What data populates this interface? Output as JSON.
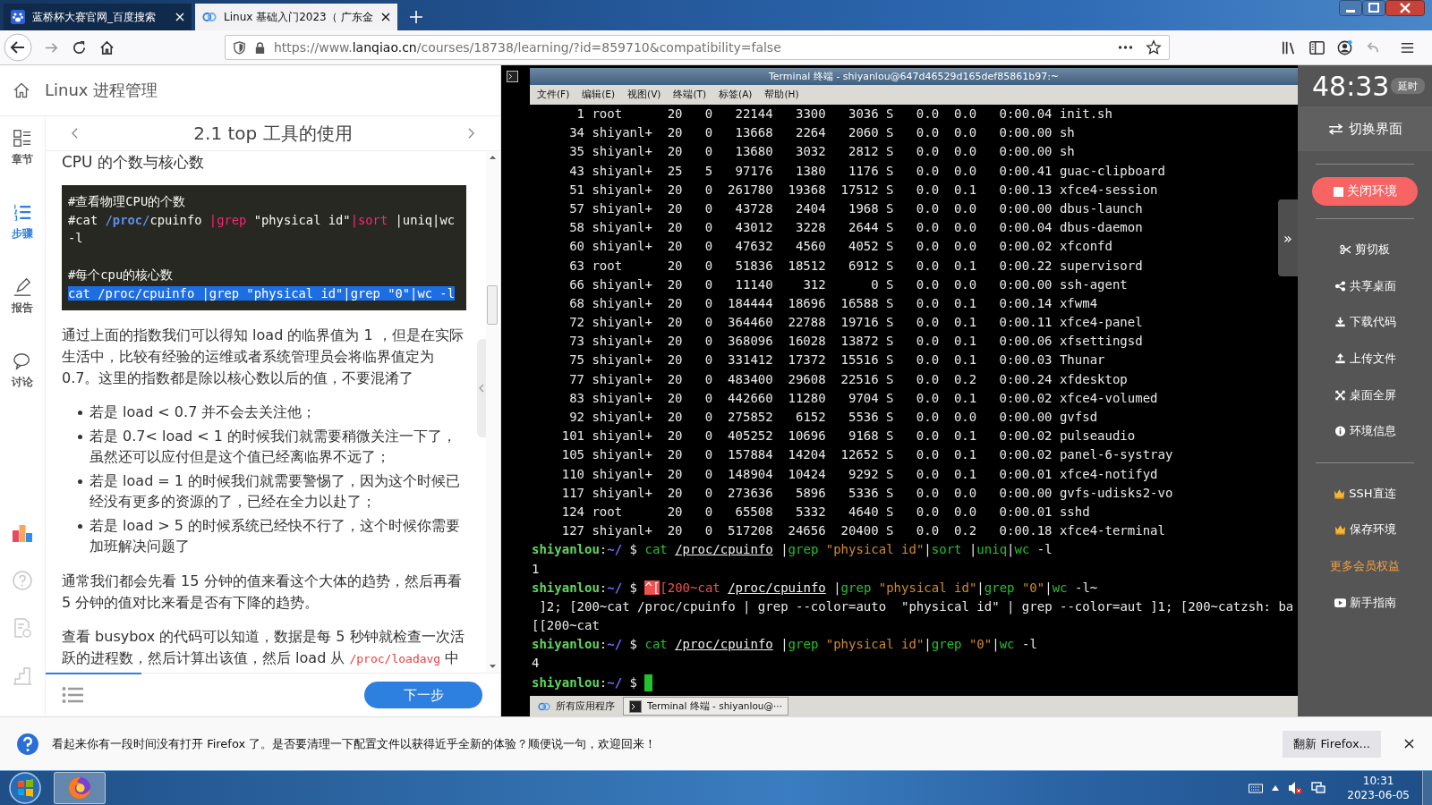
{
  "browser": {
    "tabs": [
      {
        "title": "蓝桥杯大赛官网_百度搜索",
        "kind": "baidu",
        "selected": false
      },
      {
        "title": "Linux 基础入门2023（ 广东金",
        "kind": "lanqiao",
        "selected": true
      }
    ],
    "url": {
      "prefix": "https://www.",
      "domain": "lanqiao.cn",
      "path": "/courses/18738/learning/?id=859710&compatibility=false"
    }
  },
  "course": {
    "title": "Linux 进程管理",
    "nav": [
      {
        "label": "章节",
        "kind": "chapters",
        "selected": false
      },
      {
        "label": "步骤",
        "kind": "steps",
        "selected": true
      },
      {
        "label": "报告",
        "kind": "report",
        "selected": false
      },
      {
        "label": "讨论",
        "kind": "discuss",
        "selected": false
      }
    ],
    "step_title": "2.1 top 工具的使用",
    "article": {
      "heading": "CPU 的个数与核心数",
      "code_blocks": [
        {
          "lines": [
            {
              "selected": false,
              "segments": [
                {
                  "text": "#查看物理CPU的个数",
                  "kind": "plain"
                }
              ]
            },
            {
              "selected": false,
              "segments": [
                {
                  "text": "#cat ",
                  "kind": "plain"
                },
                {
                  "text": "/proc/",
                  "kind": "path"
                },
                {
                  "text": "cpuinfo ",
                  "kind": "plain"
                },
                {
                  "text": "|grep",
                  "kind": "keyword"
                },
                {
                  "text": " \"physical id\"",
                  "kind": "plain"
                },
                {
                  "text": "|sort",
                  "kind": "keyword"
                },
                {
                  "text": " |uniq|wc -l",
                  "kind": "plain"
                }
              ]
            }
          ]
        },
        {
          "lines": [
            {
              "selected": false,
              "segments": [
                {
                  "text": "#每个cpu的核心数",
                  "kind": "plain"
                }
              ]
            },
            {
              "selected": true,
              "segments": [
                {
                  "text": "cat /proc/cpuinfo |grep \"physical id\"|grep \"0\"|wc -l",
                  "kind": "plain"
                }
              ]
            }
          ]
        }
      ],
      "paragraph_1": "通过上面的指数我们可以得知 load 的临界值为 1 ，但是在实际生活中，比较有经验的运维或者系统管理员会将临界值定为 0.7。这里的指数都是除以核心数以后的值，不要混淆了",
      "bullets": [
        "若是 load < 0.7 并不会去关注他；",
        "若是 0.7< load < 1 的时候我们就需要稍微关注一下了，虽然还可以应付但是这个值已经离临界不远了；",
        "若是 load = 1 的时候我们就需要警惕了，因为这个时候已经没有更多的资源的了，已经在全力以赴了；",
        "若是 load > 5 的时候系统已经快不行了，这个时候你需要加班解决问题了"
      ],
      "paragraph_2": "通常我们都会先看 15 分钟的值来看这个大体的趋势，然后再看 5 分钟的值对比来看是否有下降的趋势。",
      "paragraph_3": {
        "before": "查看 busybox 的代码可以知道，数据是每 5 秒钟就检查一次活跃的进程数，然后计算出该值，然后 load 从 ",
        "code": "/proc/loadavg",
        "after": " 中"
      }
    },
    "reading_progress": {
      "level": 0.21
    },
    "next_button": "下一步"
  },
  "terminal": {
    "title": "Terminal 终端 - shiyanlou@647d46529d165def85861b97:~",
    "menu": [
      "文件(F)",
      "编辑(E)",
      "视图(V)",
      "终端(T)",
      "标签(A)",
      "帮助(H)"
    ],
    "processes": [
      [
        "1",
        "root",
        "20",
        "0",
        "22144",
        "3300",
        "3036",
        "S",
        "0.0",
        "0.0",
        "0:00.04",
        "init.sh"
      ],
      [
        "34",
        "shiyanl+",
        "20",
        "0",
        "13668",
        "2264",
        "2060",
        "S",
        "0.0",
        "0.0",
        "0:00.00",
        "sh"
      ],
      [
        "35",
        "shiyanl+",
        "20",
        "0",
        "13680",
        "3032",
        "2812",
        "S",
        "0.0",
        "0.0",
        "0:00.00",
        "sh"
      ],
      [
        "43",
        "shiyanl+",
        "25",
        "5",
        "97176",
        "1380",
        "1176",
        "S",
        "0.0",
        "0.0",
        "0:00.41",
        "guac-clipboard"
      ],
      [
        "51",
        "shiyanl+",
        "20",
        "0",
        "261780",
        "19368",
        "17512",
        "S",
        "0.0",
        "0.1",
        "0:00.13",
        "xfce4-session"
      ],
      [
        "57",
        "shiyanl+",
        "20",
        "0",
        "43728",
        "2404",
        "1968",
        "S",
        "0.0",
        "0.0",
        "0:00.00",
        "dbus-launch"
      ],
      [
        "58",
        "shiyanl+",
        "20",
        "0",
        "43012",
        "3228",
        "2644",
        "S",
        "0.0",
        "0.0",
        "0:00.04",
        "dbus-daemon"
      ],
      [
        "60",
        "shiyanl+",
        "20",
        "0",
        "47632",
        "4560",
        "4052",
        "S",
        "0.0",
        "0.0",
        "0:00.02",
        "xfconfd"
      ],
      [
        "63",
        "root",
        "20",
        "0",
        "51836",
        "18512",
        "6912",
        "S",
        "0.0",
        "0.1",
        "0:00.22",
        "supervisord"
      ],
      [
        "66",
        "shiyanl+",
        "20",
        "0",
        "11140",
        "312",
        "0",
        "S",
        "0.0",
        "0.0",
        "0:00.00",
        "ssh-agent"
      ],
      [
        "68",
        "shiyanl+",
        "20",
        "0",
        "184444",
        "18696",
        "16588",
        "S",
        "0.0",
        "0.1",
        "0:00.14",
        "xfwm4"
      ],
      [
        "72",
        "shiyanl+",
        "20",
        "0",
        "364460",
        "22788",
        "19716",
        "S",
        "0.0",
        "0.1",
        "0:00.11",
        "xfce4-panel"
      ],
      [
        "73",
        "shiyanl+",
        "20",
        "0",
        "368096",
        "16028",
        "13872",
        "S",
        "0.0",
        "0.1",
        "0:00.06",
        "xfsettingsd"
      ],
      [
        "75",
        "shiyanl+",
        "20",
        "0",
        "331412",
        "17372",
        "15516",
        "S",
        "0.0",
        "0.1",
        "0:00.03",
        "Thunar"
      ],
      [
        "77",
        "shiyanl+",
        "20",
        "0",
        "483400",
        "29608",
        "22516",
        "S",
        "0.0",
        "0.2",
        "0:00.24",
        "xfdesktop"
      ],
      [
        "83",
        "shiyanl+",
        "20",
        "0",
        "442660",
        "11280",
        "9704",
        "S",
        "0.0",
        "0.1",
        "0:00.02",
        "xfce4-volumed"
      ],
      [
        "92",
        "shiyanl+",
        "20",
        "0",
        "275852",
        "6152",
        "5536",
        "S",
        "0.0",
        "0.0",
        "0:00.00",
        "gvfsd"
      ],
      [
        "101",
        "shiyanl+",
        "20",
        "0",
        "405252",
        "10696",
        "9168",
        "S",
        "0.0",
        "0.1",
        "0:00.02",
        "pulseaudio"
      ],
      [
        "105",
        "shiyanl+",
        "20",
        "0",
        "157884",
        "14204",
        "12652",
        "S",
        "0.0",
        "0.1",
        "0:00.02",
        "panel-6-systray"
      ],
      [
        "110",
        "shiyanl+",
        "20",
        "0",
        "148904",
        "10424",
        "9292",
        "S",
        "0.0",
        "0.1",
        "0:00.01",
        "xfce4-notifyd"
      ],
      [
        "117",
        "shiyanl+",
        "20",
        "0",
        "273636",
        "5896",
        "5336",
        "S",
        "0.0",
        "0.0",
        "0:00.00",
        "gvfs-udisks2-vo"
      ],
      [
        "124",
        "root",
        "20",
        "0",
        "65508",
        "5332",
        "4640",
        "S",
        "0.0",
        "0.0",
        "0:00.01",
        "sshd"
      ],
      [
        "127",
        "shiyanl+",
        "20",
        "0",
        "517208",
        "24656",
        "20400",
        "S",
        "0.0",
        "0.2",
        "0:00.18",
        "xfce4-terminal"
      ]
    ],
    "shell_lines": [
      {
        "cursor": false,
        "segments": [
          {
            "text": "shiyanlou",
            "kind": "user"
          },
          {
            "text": ":",
            "kind": "plain"
          },
          {
            "text": "~/",
            "kind": "path"
          },
          {
            "text": " $ ",
            "kind": "plain"
          },
          {
            "text": "cat ",
            "kind": "cmd"
          },
          {
            "text": "/proc/cpuinfo",
            "kind": "arg"
          },
          {
            "text": " |",
            "kind": "plain"
          },
          {
            "text": "grep ",
            "kind": "cmd"
          },
          {
            "text": "\"physical id\"",
            "kind": "str"
          },
          {
            "text": "|",
            "kind": "plain"
          },
          {
            "text": "sort",
            "kind": "cmd"
          },
          {
            "text": " |",
            "kind": "plain"
          },
          {
            "text": "uniq",
            "kind": "cmd"
          },
          {
            "text": "|",
            "kind": "plain"
          },
          {
            "text": "wc",
            "kind": "cmd"
          },
          {
            "text": " -l",
            "kind": "plain"
          }
        ]
      },
      {
        "cursor": false,
        "segments": [
          {
            "text": "1",
            "kind": "plain"
          }
        ]
      },
      {
        "cursor": false,
        "segments": [
          {
            "text": "shiyanlou",
            "kind": "user"
          },
          {
            "text": ":",
            "kind": "plain"
          },
          {
            "text": "~/",
            "kind": "path"
          },
          {
            "text": " $ ",
            "kind": "plain"
          },
          {
            "text": "^[",
            "kind": "esc"
          },
          {
            "text": "[200~cat ",
            "kind": "error"
          },
          {
            "text": "/proc/cpuinfo",
            "kind": "arg"
          },
          {
            "text": " |",
            "kind": "plain"
          },
          {
            "text": "grep ",
            "kind": "cmd"
          },
          {
            "text": "\"physical id\"",
            "kind": "str"
          },
          {
            "text": "|",
            "kind": "plain"
          },
          {
            "text": "grep ",
            "kind": "cmd"
          },
          {
            "text": "\"0\"",
            "kind": "str"
          },
          {
            "text": "|",
            "kind": "plain"
          },
          {
            "text": "wc",
            "kind": "cmd"
          },
          {
            "text": " -l~",
            "kind": "plain"
          }
        ]
      },
      {
        "cursor": false,
        "segments": [
          {
            "text": " ]2; [200~cat /proc/cpuinfo | grep --color=auto  \"physical id\" | grep --color=aut ]1; [200~catzsh: ba",
            "kind": "plain"
          }
        ]
      },
      {
        "cursor": false,
        "segments": [
          {
            "text": "[[200~cat",
            "kind": "plain"
          }
        ]
      },
      {
        "cursor": false,
        "segments": [
          {
            "text": "shiyanlou",
            "kind": "user"
          },
          {
            "text": ":",
            "kind": "plain"
          },
          {
            "text": "~/",
            "kind": "path"
          },
          {
            "text": " $ ",
            "kind": "plain"
          },
          {
            "text": "cat ",
            "kind": "cmd"
          },
          {
            "text": "/proc/cpuinfo",
            "kind": "arg"
          },
          {
            "text": " |",
            "kind": "plain"
          },
          {
            "text": "grep ",
            "kind": "cmd"
          },
          {
            "text": "\"physical id\"",
            "kind": "str"
          },
          {
            "text": "|",
            "kind": "plain"
          },
          {
            "text": "grep ",
            "kind": "cmd"
          },
          {
            "text": "\"0\"",
            "kind": "str"
          },
          {
            "text": "|",
            "kind": "plain"
          },
          {
            "text": "wc",
            "kind": "cmd"
          },
          {
            "text": " -l",
            "kind": "plain"
          }
        ]
      },
      {
        "cursor": false,
        "segments": [
          {
            "text": "4",
            "kind": "plain"
          }
        ]
      },
      {
        "cursor": true,
        "segments": [
          {
            "text": "shiyanlou",
            "kind": "user"
          },
          {
            "text": ":",
            "kind": "plain"
          },
          {
            "text": "~/",
            "kind": "path"
          },
          {
            "text": " $ ",
            "kind": "plain"
          }
        ]
      }
    ],
    "taskbar": [
      {
        "label": "所有应用程序",
        "kind": "apps",
        "selected": false
      },
      {
        "label": "Terminal 终端 - shiyanlou@···",
        "kind": "terminal",
        "selected": true
      }
    ]
  },
  "env_panel": {
    "timer": "48:33",
    "extend_button": "延时",
    "switch_button": "切换界面",
    "close_button": "关闭环境",
    "expand_handle": "»",
    "tools": [
      {
        "label": "剪切板",
        "kind": "scissors"
      },
      {
        "label": "共享桌面",
        "kind": "share"
      },
      {
        "label": "下载代码",
        "kind": "download"
      },
      {
        "label": "上传文件",
        "kind": "upload"
      },
      {
        "label": "桌面全屏",
        "kind": "fullscreen"
      },
      {
        "label": "环境信息",
        "kind": "info"
      }
    ],
    "member": [
      {
        "label": "SSH直连",
        "kind": "crown"
      },
      {
        "label": "保存环境",
        "kind": "crown"
      },
      {
        "label": "更多会员权益",
        "kind": "link"
      },
      {
        "label": "新手指南",
        "kind": "video"
      }
    ]
  },
  "notification": {
    "message": "看起来你有一段时间没有打开 Firefox 了。是否要清理一下配置文件以获得近乎全新的体验？顺便说一句，欢迎回来！",
    "button": "翻新 Firefox..."
  },
  "taskbar": {
    "time": "10:31",
    "date": "2023-06-05"
  }
}
